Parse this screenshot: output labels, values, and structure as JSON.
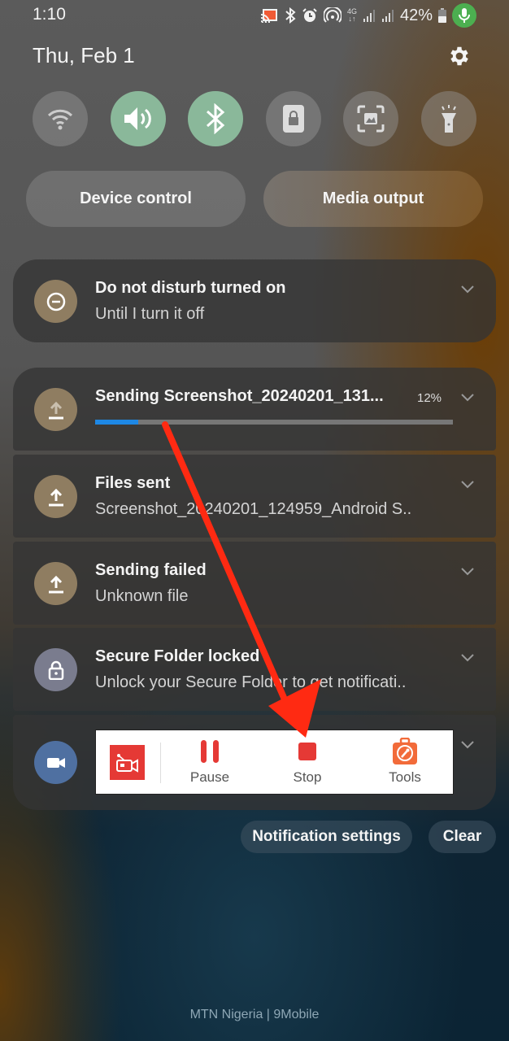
{
  "status_bar": {
    "time": "1:10",
    "icons": [
      "cast-icon",
      "bluetooth-icon",
      "alarm-icon",
      "hotspot-icon",
      "4g-icon",
      "signal-icon",
      "signal-icon"
    ],
    "network_label": "4G",
    "battery_percent": "42%",
    "mic_active_color": "#4caf50"
  },
  "header": {
    "date": "Thu, Feb 1"
  },
  "quick_settings": {
    "tiles": [
      {
        "name": "wifi",
        "active": false
      },
      {
        "name": "sound",
        "active": true
      },
      {
        "name": "bluetooth",
        "active": true
      },
      {
        "name": "secure-folder",
        "active": false
      },
      {
        "name": "screen-capture",
        "active": false
      },
      {
        "name": "flashlight",
        "active": false
      }
    ],
    "active_color": "#8ab89a",
    "device_control_label": "Device control",
    "media_output_label": "Media output"
  },
  "notifications": {
    "dnd": {
      "title": "Do not disturb turned on",
      "subtitle": "Until I turn it off"
    },
    "sending": {
      "title": "Sending Screenshot_20240201_131...",
      "percent_label": "12%",
      "progress": 0.12,
      "progress_color": "#1e88e5"
    },
    "files_sent": {
      "title": "Files sent",
      "subtitle": "Screenshot_20240201_124959_Android S.."
    },
    "sending_failed": {
      "title": "Sending failed",
      "subtitle": "Unknown file"
    },
    "secure_folder": {
      "title": "Secure Folder locked",
      "subtitle": "Unlock your Secure Folder to get notificati.."
    },
    "recorder": {
      "actions": [
        {
          "label": "Pause",
          "icon": "pause-icon"
        },
        {
          "label": "Stop",
          "icon": "stop-icon"
        },
        {
          "label": "Tools",
          "icon": "tools-icon"
        }
      ],
      "accent_color": "#e53935"
    }
  },
  "footer": {
    "notification_settings_label": "Notification settings",
    "clear_label": "Clear",
    "carrier": "MTN Nigeria | 9Mobile"
  },
  "annotation": {
    "arrow_color": "#ff2a12"
  }
}
